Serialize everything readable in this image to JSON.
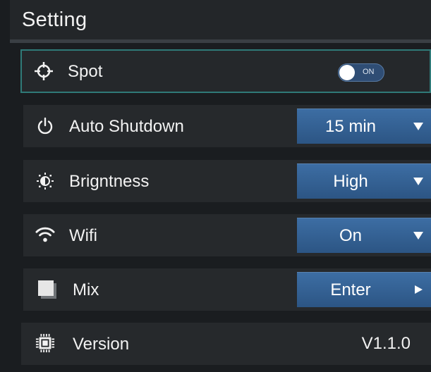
{
  "header": {
    "title": "Setting"
  },
  "settings": {
    "spot": {
      "label": "Spot",
      "icon": "crosshair-icon",
      "toggle_text": "ON",
      "toggle_on": true
    },
    "auto_shutdown": {
      "label": "Auto Shutdown",
      "icon": "power-icon",
      "value": "15 min",
      "arrow": "down"
    },
    "brightness": {
      "label": "Brigntness",
      "icon": "brightness-icon",
      "value": "High",
      "arrow": "down"
    },
    "wifi": {
      "label": "Wifi",
      "icon": "wifi-icon",
      "value": "On",
      "arrow": "down"
    },
    "mix": {
      "label": "Mix",
      "icon": "mix-square-icon",
      "value": "Enter",
      "arrow": "right"
    },
    "version": {
      "label": "Version",
      "icon": "chip-icon",
      "value": "V1.1.0"
    }
  },
  "colors": {
    "background": "#1a1d20",
    "row": "#26292c",
    "selected_border": "#2f7a78",
    "dropdown": "#3d6ea4",
    "text": "#f2f2f2"
  }
}
